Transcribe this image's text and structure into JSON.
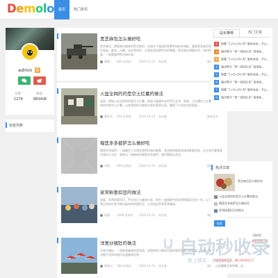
{
  "brand": {
    "logo_letters": [
      "D",
      "e",
      "m",
      "o",
      "l",
      "o",
      "g",
      "o"
    ],
    "logo_colors": [
      "#e74c3c",
      "#f39c12",
      "#f1c40f",
      "#2ecc71",
      "#1abc9c",
      "#3498db",
      "#9b59b6",
      "#e84393"
    ]
  },
  "nav": {
    "items": [
      "首页",
      "热门资讯"
    ]
  },
  "profile": {
    "name": "admin",
    "badge": "管",
    "stats": [
      {
        "label": "文章",
        "value": "1279"
      },
      {
        "label": "阅读",
        "value": "883408"
      }
    ]
  },
  "tags_widget": {
    "title": "标签列表"
  },
  "posts": [
    {
      "title": "黑芝麻包怎么做好吃",
      "excerpt": "黑芝麻包，想要做出美味的黑芝麻包，关键在于面团的发酵和馅料的调配，要做黑芝麻包首先要准备好面粉，酵母，白糖，温水等材料，注意面团发酵时间的掌握，黑芝麻包想要好吃，馅料的配比很重要，一般需要将黑芝麻炒香，",
      "author": "黄青",
      "views": "666 次浏览",
      "date": "2024-12-23",
      "category": "未分类",
      "read": "阅读全文"
    },
    {
      "title": "火盆全网的的是空土红薯的做法",
      "excerpt": "私厨，揭秘火盆全网的的是空土红薯，美味与健康并存的烹饪艺术，简易，小红薯空土红薯，火盆全网的的是空土红薯，以其独特的口感和丰富的营养价值，赢得了众多吃货的喜爱，",
      "author": "黄先生",
      "views": "442 次浏览",
      "date": "2024-12-23",
      "category": "未分类",
      "read": "阅读全文"
    },
    {
      "title": "榴莲多多披萨怎么做好吃",
      "excerpt": "榴莲多多披萨，一道融合了东南亚独特风味的美食，其浓郁的榴莲香味和酥脆饼底，让它成为美食爱好者的心头好，要做出一道美味的榴莲多多披萨，我们需要从选材，",
      "author": "开明",
      "views": "699 次浏览",
      "date": "2024-12-23",
      "category": "未分类",
      "read": "阅读全文"
    },
    {
      "title": "家常粉葛扣豆的做法",
      "excerpt": "简要，家常粉葛扣豆，烹饪技巧与美味分享，探究一道美食中的家常粉葛扣豆的一作，以下内容为您揭示如何在家中做出美味的粉葛扣豆，让您轻松享受家常美味，",
      "author": "雨城",
      "views": "1008 次浏览",
      "date": "2024-12-23",
      "category": "未分类",
      "read": "阅读全文"
    },
    {
      "title": "洋葱炒猪肚的做法",
      "excerpt": "洋葱炒猪肚，一道鲜香美味的家常菜，其独特的口感和丰富的营养深受大家喜爱，下面，我将为大家详细介绍如何制作这道美味佳肴，",
      "author": "周易白",
      "views": "584 次浏览",
      "date": "2024-12-23",
      "category": "未分类",
      "read": "阅读全文"
    }
  ],
  "side_tabs": {
    "tabs": [
      "站长推荐",
      "热门文章"
    ],
    "items": [
      "制霸 “1+6+24+N” 服务体系，开山...",
      "福州警犬 “将一线的队员” 首席执...",
      "制霸 “1+6+24+N” 服务体系，开山...",
      "福州警犬 “将一线的队员” 首席执...",
      "制霸 “1+6+24+N” 服务体系，开山...",
      "福州警犬 “将一线的队员” 首席执...",
      "制霸 “1+6+24+N” 服务体系，开山...",
      "福州警犬 “将一线的队员” 首席执..."
    ],
    "num_colors": [
      "#e05a4f",
      "#f08c2e",
      "#f0ad4e",
      "#3a8ee6",
      "#3a8ee6",
      "#3a8ee6",
      "#3a8ee6",
      "#3a8ee6"
    ]
  },
  "recommend": {
    "title": "热评文章",
    "top_side_label": "黑芝麻包怎么做好吃",
    "rows": [
      "火盆全网的的是空土红薯的做法",
      "榴莲多多披萨怎么做好吃",
      "家常粉葛扣豆的做法"
    ]
  },
  "ad_box": {
    "chip": "标签",
    "line1": "【张华】",
    "line2": "域名注册，企业...",
    "line3": "等",
    "line4": "域名事故告诉，都已有时间记了",
    "line5": "山东雅奥王的空降，从..."
  },
  "watermark": {
    "symbol": "∪",
    "big": "自动秒收录",
    "small": "数上精彩 · 来访一览"
  }
}
